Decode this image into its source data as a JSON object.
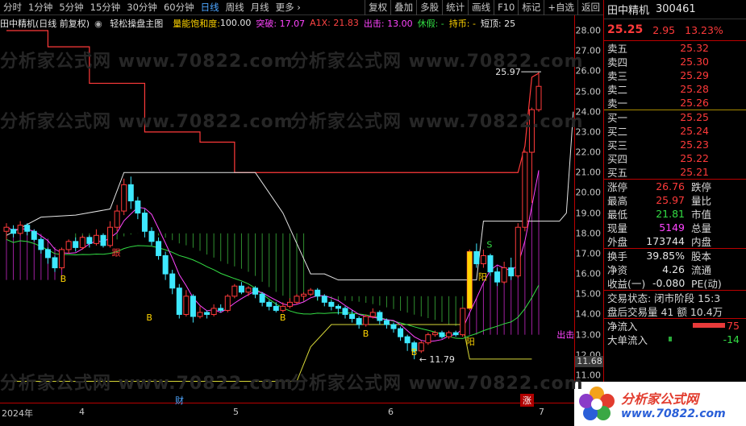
{
  "toolbar": {
    "periods": [
      "分时",
      "1分钟",
      "5分钟",
      "15分钟",
      "30分钟",
      "60分钟",
      "日线",
      "周线",
      "月线",
      "更多"
    ],
    "active_period": "日线",
    "tools": [
      "复权",
      "叠加",
      "多股",
      "统计",
      "画线",
      "F10",
      "标记",
      "+自选",
      "返回"
    ]
  },
  "infoline": {
    "stock": "田中精机(日线 前复权)",
    "formula": "轻松操盘主图",
    "vol_sat_label": "量能饱和度:",
    "vol_sat_value": "100.00",
    "tupo": "突破: 17.07",
    "a1x": "A1X: 21.83",
    "chuji": "出击: 13.00",
    "xiujia": "休假: -",
    "chibi": "持币: -",
    "duanding": "短顶: 25"
  },
  "chart_data": {
    "type": "candlestick",
    "ylim": [
      10.5,
      28.3
    ],
    "yticks": [
      28.0,
      27.0,
      26.0,
      25.0,
      24.0,
      23.0,
      22.0,
      21.0,
      20.0,
      19.0,
      18.0,
      17.0,
      16.0,
      15.0,
      14.0,
      13.0,
      12.0,
      11.0
    ],
    "xticks": [
      "2024年",
      "4",
      "5",
      "6",
      "7"
    ],
    "annotations": [
      "25.97",
      "11.79",
      "跟",
      "B",
      "S",
      "阳",
      "出击"
    ],
    "x_badges": [
      "财",
      "涨"
    ],
    "current_price_tag": "11.68",
    "candles": [
      [
        18.1,
        18.3,
        17.7,
        18.5
      ],
      [
        18.2,
        18.0,
        17.8,
        18.4
      ],
      [
        18.0,
        18.4,
        17.9,
        18.6
      ],
      [
        18.4,
        18.1,
        17.9,
        18.5
      ],
      [
        18.1,
        17.7,
        17.6,
        18.2
      ],
      [
        17.7,
        17.2,
        17.0,
        17.8
      ],
      [
        17.2,
        16.8,
        16.5,
        17.3
      ],
      [
        16.8,
        16.3,
        16.1,
        16.9
      ],
      [
        16.3,
        17.2,
        16.2,
        17.3
      ],
      [
        17.2,
        17.6,
        17.0,
        17.7
      ],
      [
        17.6,
        17.3,
        17.1,
        17.8
      ],
      [
        17.3,
        17.8,
        17.2,
        17.9
      ],
      [
        17.8,
        17.5,
        17.3,
        17.9
      ],
      [
        17.5,
        17.9,
        17.4,
        18.2
      ],
      [
        17.9,
        17.4,
        17.3,
        18.0
      ],
      [
        17.4,
        18.3,
        17.3,
        18.6
      ],
      [
        18.3,
        19.1,
        18.1,
        19.4
      ],
      [
        19.1,
        20.4,
        18.9,
        20.7
      ],
      [
        20.4,
        19.6,
        19.2,
        20.8
      ],
      [
        19.6,
        19.0,
        18.7,
        19.8
      ],
      [
        19.0,
        18.1,
        17.8,
        19.2
      ],
      [
        18.1,
        17.6,
        17.4,
        18.3
      ],
      [
        17.6,
        16.9,
        16.7,
        17.8
      ],
      [
        16.9,
        16.0,
        15.7,
        17.1
      ],
      [
        16.0,
        15.3,
        15.0,
        16.2
      ],
      [
        15.3,
        14.0,
        13.8,
        15.5
      ],
      [
        14.0,
        14.9,
        13.9,
        15.2
      ],
      [
        14.9,
        13.9,
        13.6,
        15.0
      ],
      [
        13.9,
        14.1,
        13.8,
        14.4
      ],
      [
        14.1,
        14.0,
        13.8,
        14.2
      ],
      [
        14.0,
        14.3,
        13.9,
        14.5
      ],
      [
        14.3,
        14.2,
        14.1,
        14.5
      ],
      [
        14.2,
        14.9,
        14.1,
        15.0
      ],
      [
        14.9,
        15.4,
        14.8,
        15.5
      ],
      [
        15.4,
        15.1,
        15.0,
        15.6
      ],
      [
        15.1,
        15.3,
        14.9,
        15.4
      ],
      [
        15.3,
        15.0,
        14.8,
        15.4
      ],
      [
        15.0,
        14.6,
        14.4,
        15.1
      ],
      [
        14.6,
        14.4,
        14.2,
        14.7
      ],
      [
        14.4,
        14.2,
        14.1,
        14.6
      ],
      [
        14.2,
        14.4,
        14.1,
        14.6
      ],
      [
        14.4,
        14.6,
        14.3,
        14.8
      ],
      [
        14.6,
        14.9,
        14.5,
        15.0
      ],
      [
        14.9,
        15.0,
        14.7,
        15.1
      ],
      [
        15.0,
        15.2,
        14.9,
        15.3
      ],
      [
        15.2,
        14.9,
        14.7,
        15.3
      ],
      [
        14.9,
        14.6,
        14.4,
        15.0
      ],
      [
        14.6,
        14.4,
        14.2,
        14.7
      ],
      [
        14.4,
        14.3,
        14.0,
        14.5
      ],
      [
        14.3,
        14.0,
        13.8,
        14.4
      ],
      [
        14.0,
        13.8,
        13.6,
        14.2
      ],
      [
        13.8,
        13.5,
        13.3,
        13.9
      ],
      [
        13.5,
        13.9,
        13.4,
        14.0
      ],
      [
        13.9,
        14.1,
        13.8,
        14.3
      ],
      [
        14.1,
        13.7,
        13.5,
        14.2
      ],
      [
        13.7,
        13.5,
        13.3,
        13.8
      ],
      [
        13.5,
        13.3,
        13.1,
        13.6
      ],
      [
        13.3,
        12.9,
        12.7,
        13.4
      ],
      [
        12.9,
        12.6,
        12.2,
        13.0
      ],
      [
        12.6,
        12.2,
        11.79,
        12.7
      ],
      [
        12.2,
        12.6,
        12.1,
        12.7
      ],
      [
        12.6,
        13.0,
        12.5,
        13.1
      ],
      [
        13.0,
        13.1,
        12.9,
        13.2
      ],
      [
        13.1,
        12.9,
        12.8,
        13.2
      ],
      [
        12.9,
        13.1,
        12.8,
        13.2
      ],
      [
        13.1,
        13.0,
        12.9,
        13.2
      ],
      [
        13.0,
        14.3,
        12.9,
        14.3
      ],
      [
        14.3,
        17.1,
        14.2,
        17.2
      ],
      [
        17.1,
        16.5,
        16.3,
        17.5
      ],
      [
        16.5,
        16.9,
        16.3,
        17.2
      ],
      [
        16.9,
        16.1,
        15.9,
        17.0
      ],
      [
        16.1,
        15.6,
        15.4,
        16.3
      ],
      [
        15.6,
        16.3,
        15.5,
        16.6
      ],
      [
        16.3,
        15.9,
        15.7,
        16.8
      ],
      [
        15.9,
        18.3,
        15.8,
        18.5
      ],
      [
        18.3,
        22.0,
        18.1,
        22.1
      ],
      [
        22.0,
        24.1,
        19.5,
        24.2
      ],
      [
        24.1,
        25.25,
        24.0,
        25.97
      ]
    ]
  },
  "panel": {
    "name": "田中精机",
    "code": "300461",
    "price": "25.25",
    "change": "2.95",
    "pct": "13.23%",
    "asks": [
      {
        "label": "卖五",
        "price": "25.32"
      },
      {
        "label": "卖四",
        "price": "25.30"
      },
      {
        "label": "卖三",
        "price": "25.29"
      },
      {
        "label": "卖二",
        "price": "25.28"
      },
      {
        "label": "卖一",
        "price": "25.26"
      }
    ],
    "bids": [
      {
        "label": "买一",
        "price": "25.25"
      },
      {
        "label": "买二",
        "price": "25.24"
      },
      {
        "label": "买三",
        "price": "25.23"
      },
      {
        "label": "买四",
        "price": "25.22"
      },
      {
        "label": "买五",
        "price": "25.21"
      }
    ],
    "stats": [
      {
        "label": "涨停",
        "value": "26.76",
        "right": "跌停"
      },
      {
        "label": "最高",
        "value": "25.97",
        "right": "量比"
      },
      {
        "label": "最低",
        "value": "21.81",
        "right": "市值"
      },
      {
        "label": "现量",
        "value": "5149",
        "right": "总量"
      },
      {
        "label": "外盘",
        "value": "173744",
        "right": "内盘"
      }
    ],
    "stats2": [
      {
        "label": "换手",
        "value": "39.85%",
        "right": "股本"
      },
      {
        "label": "净资",
        "value": "4.26",
        "right": "流通"
      },
      {
        "label": "收益(一)",
        "value": "-0.080",
        "right": "PE(动)"
      }
    ],
    "trade_status": "交易状态: 闭市阶段 15:3",
    "after_trade": "盘后交易量 41 额 10.4万",
    "net_inflow_label": "净流入",
    "net_inflow_value": "75",
    "big_inflow_label": "大单流入",
    "big_inflow_value": "-14"
  },
  "logo": {
    "line1": "分析家公式网",
    "line2": "www.70822.com"
  },
  "watermark": "分析家公式网 www.70822.com",
  "colors": {
    "up": "#ff3a3a",
    "down": "#3ee8ff",
    "accent": "#4ea6ff",
    "frame": "#b00000"
  }
}
